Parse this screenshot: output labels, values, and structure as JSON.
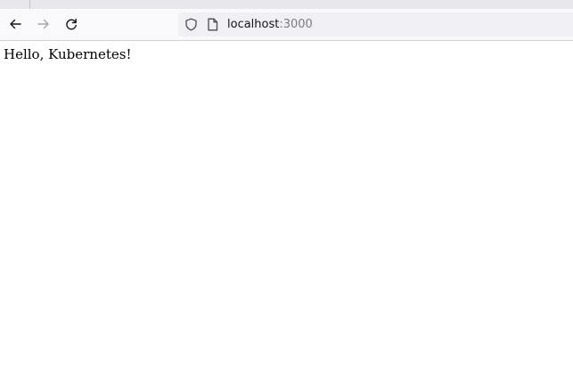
{
  "browser": {
    "url": {
      "host": "localhost",
      "port": ":3000"
    },
    "nav_icons": {
      "back": "back-arrow-icon",
      "forward": "forward-arrow-icon",
      "reload": "reload-icon",
      "tracking_protection": "shield-icon",
      "page_info": "page-icon"
    },
    "colors": {
      "toolbar": "#f9f9fb",
      "urlbar": "#f0f0f4",
      "tabstrip": "#e8e8ec"
    }
  },
  "page": {
    "body_text": "Hello, Kubernetes!"
  }
}
